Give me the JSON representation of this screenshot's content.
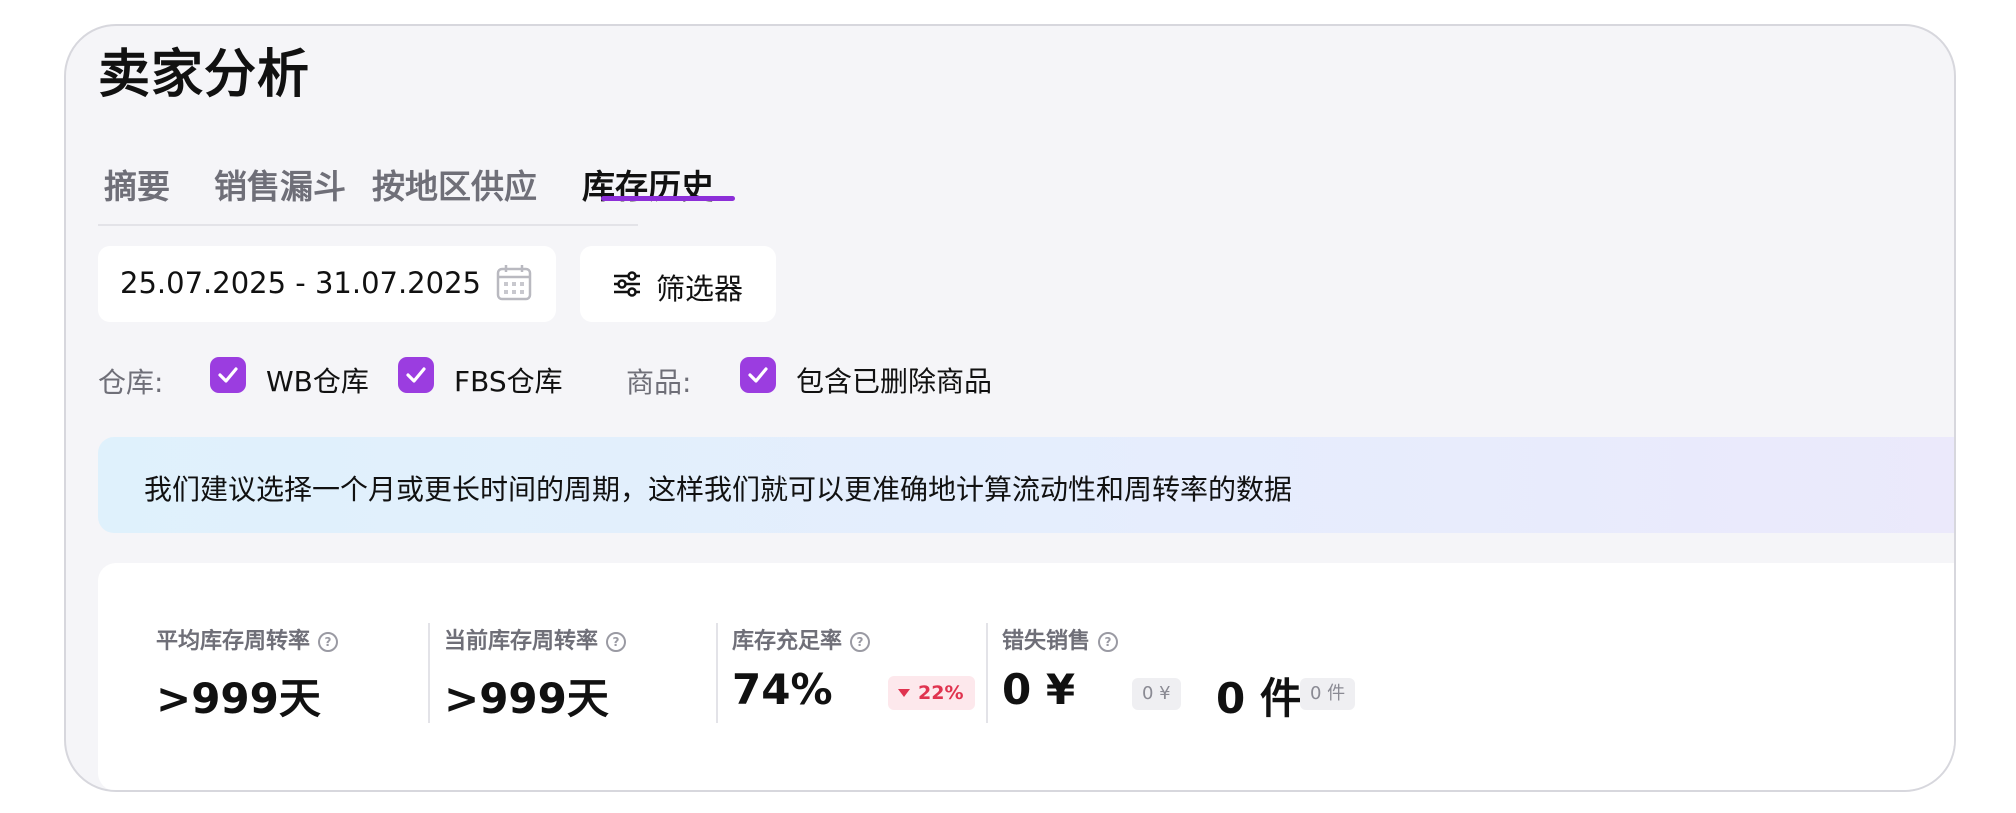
{
  "page": {
    "title": "卖家分析"
  },
  "tabs": [
    {
      "label": "摘要"
    },
    {
      "label": "销售漏斗"
    },
    {
      "label": "按地区供应"
    },
    {
      "label": "库存历史"
    }
  ],
  "active_tab": "库存历史",
  "accent_color": "#8c2ed8",
  "date_range": {
    "value": "25.07.2025 - 31.07.2025",
    "icon": "calendar-icon"
  },
  "filter_button": {
    "label": "筛选器",
    "icon": "sliders-icon"
  },
  "warehouse": {
    "label": "仓库:",
    "options": [
      {
        "label": "WB仓库",
        "checked": true
      },
      {
        "label": "FBS仓库",
        "checked": true
      }
    ]
  },
  "products": {
    "label": "商品:",
    "options": [
      {
        "label": "包含已删除商品",
        "checked": true
      }
    ]
  },
  "notice": {
    "text": "我们建议选择一个月或更长时间的周期，这样我们就可以更准确地计算流动性和周转率的数据"
  },
  "stats": [
    {
      "label": "平均库存周转率",
      "value": ">999天"
    },
    {
      "label": "当前库存周转率",
      "value": ">999天"
    },
    {
      "label": "库存充足率",
      "value": "74%",
      "change": "22%",
      "change_direction": "down"
    },
    {
      "label": "错失销售",
      "value_money": "0 ¥",
      "money_badge": "0 ¥",
      "value_units": "0 件",
      "units_badge": "0 件"
    }
  ]
}
